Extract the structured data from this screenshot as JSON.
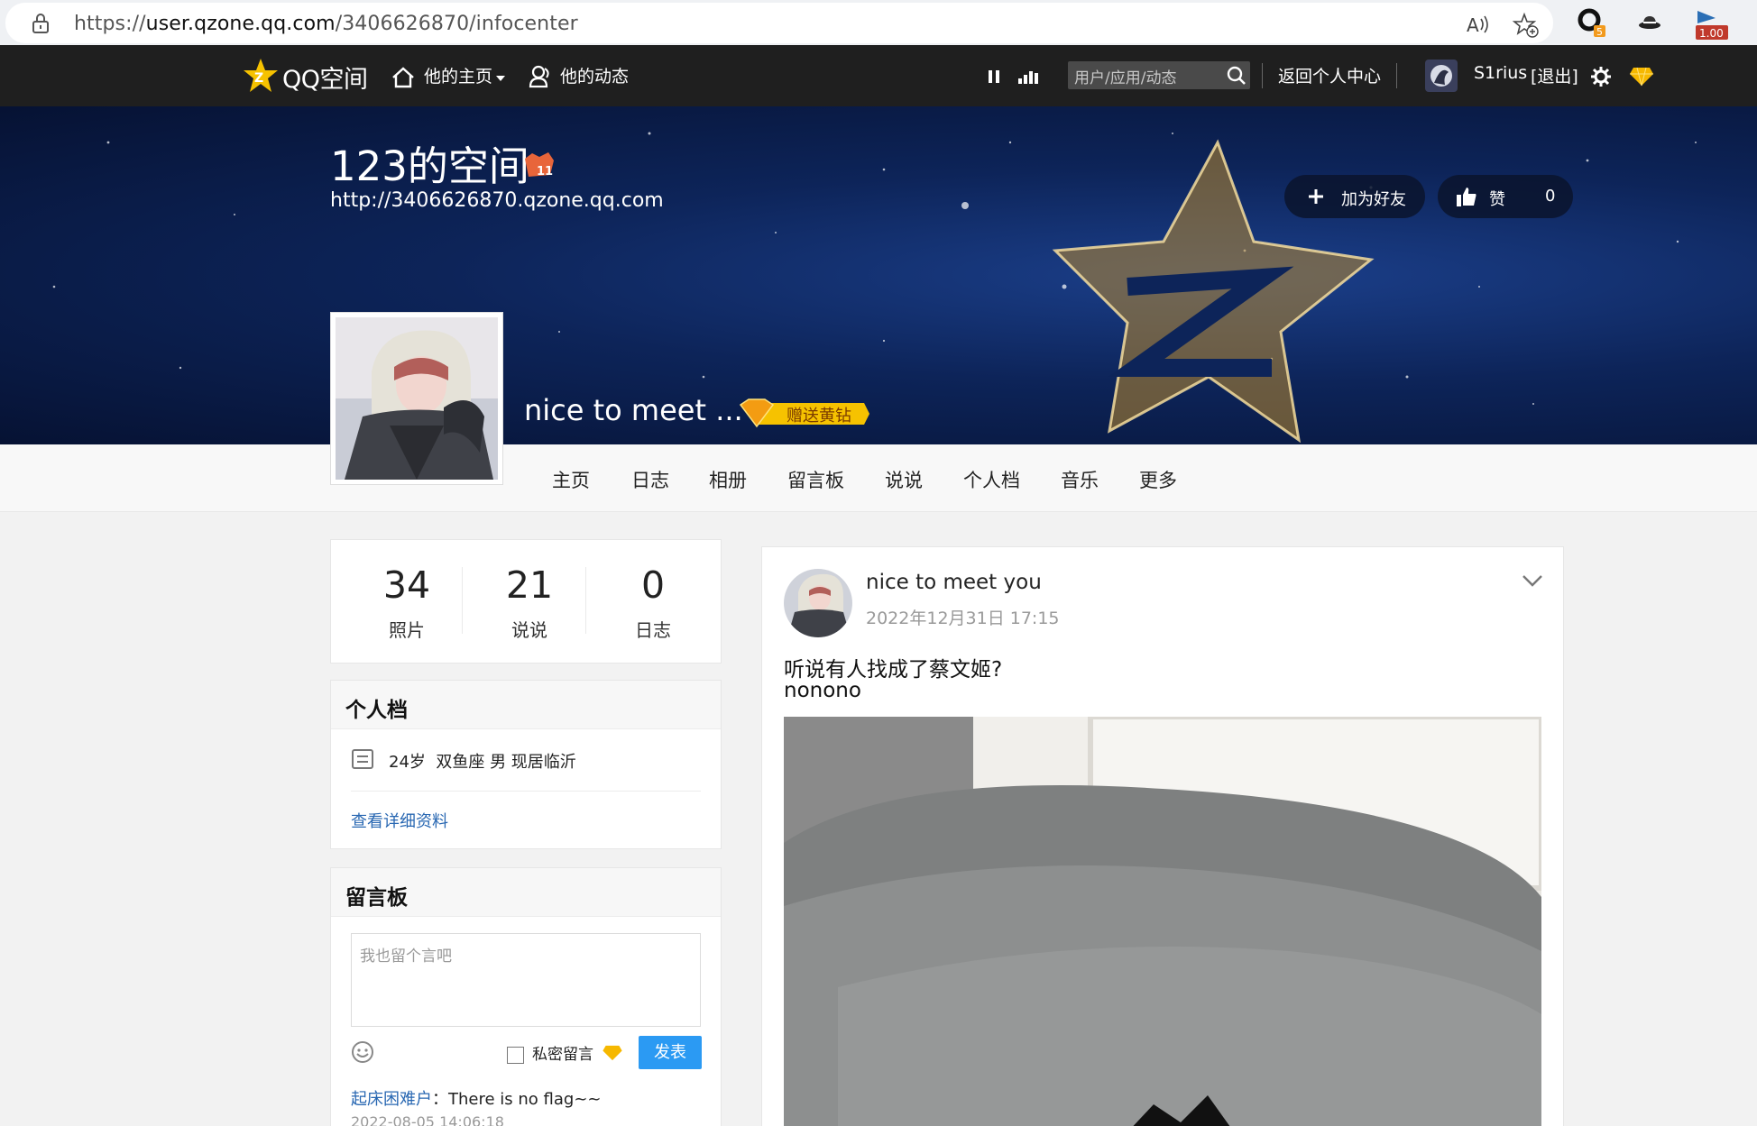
{
  "browser": {
    "url_prefix": "https://",
    "url_host": "user.qzone.qq.com",
    "url_path": "/3406626870/infocenter",
    "ext_badge_count": "5",
    "ext_badge_value": "1.00"
  },
  "topnav": {
    "logo_text": "QQ空间",
    "his_home": "他的主页",
    "his_feed": "他的动态",
    "search_placeholder": "用户/应用/动态",
    "back_center": "返回个人中心",
    "username": "S1rius",
    "logout": "[退出]"
  },
  "banner": {
    "space_title": "123的空间",
    "level_badge": "11",
    "space_url": "http://3406626870.qzone.qq.com",
    "add_friend": "加为好友",
    "like_label": "赞",
    "like_count": "0",
    "nickname": "nice to meet ...",
    "gift_diamond": "赠送黄钻"
  },
  "tabs": [
    "主页",
    "日志",
    "相册",
    "留言板",
    "说说",
    "个人档",
    "音乐",
    "更多"
  ],
  "stats": [
    {
      "value": "34",
      "label": "照片"
    },
    {
      "value": "21",
      "label": "说说"
    },
    {
      "value": "0",
      "label": "日志"
    }
  ],
  "profile": {
    "title": "个人档",
    "info": "24岁  双鱼座 男 现居临沂",
    "detail_link": "查看详细资料"
  },
  "guestbook": {
    "title": "留言板",
    "placeholder": "我也留个言吧",
    "private_label": "私密留言",
    "submit": "发表",
    "entry_author": "起床困难户",
    "entry_colon": "：",
    "entry_text": "There is no flag~~",
    "entry_time": "2022-08-05 14:06:18"
  },
  "feed": {
    "author": "nice to meet you",
    "time": "2022年12月31日 17:15",
    "line1": "听说有人找成了蔡文姬?",
    "line2": "nonono"
  },
  "colors": {
    "topnav_bg": "#1f1f1f",
    "banner_bg": "#0d2459",
    "accent_blue": "#2b9af3",
    "link_blue": "#2867b2",
    "gold": "#f6b800"
  }
}
